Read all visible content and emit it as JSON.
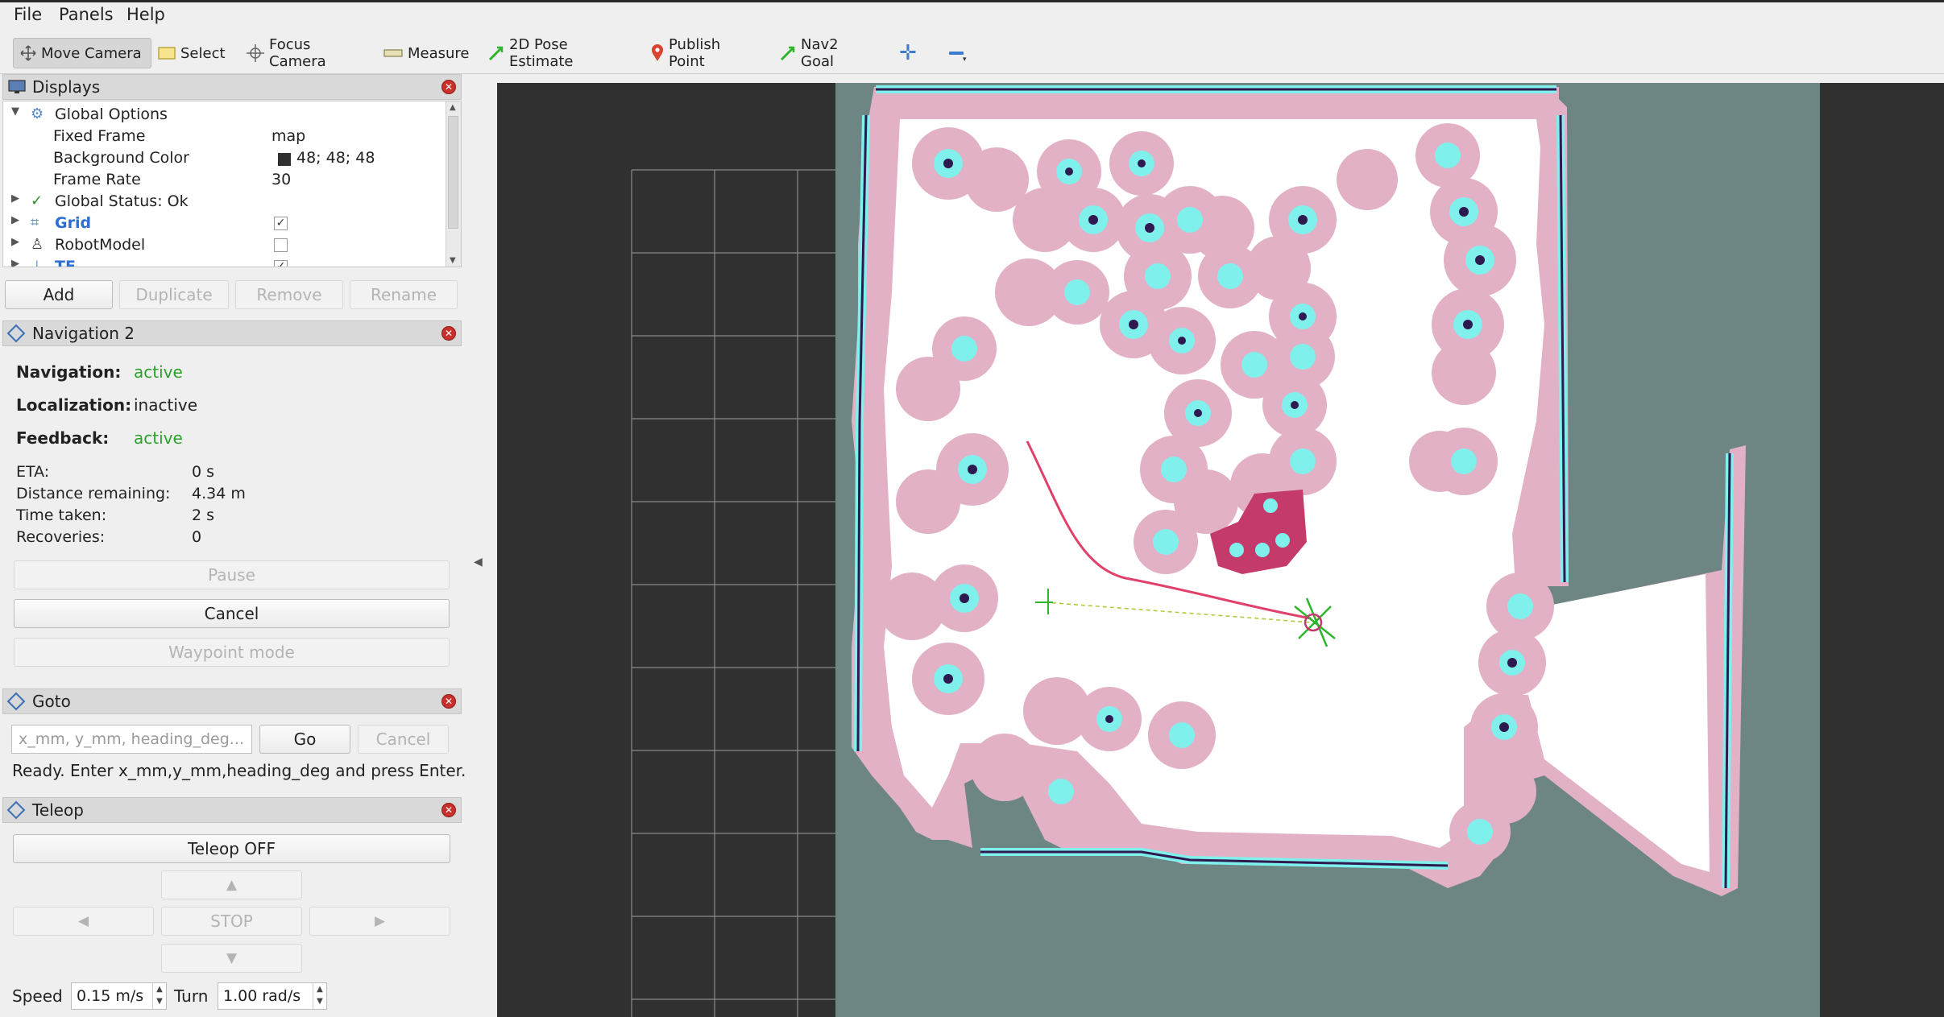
{
  "menu": {
    "file": "File",
    "panels": "Panels",
    "help": "Help"
  },
  "toolbar": {
    "move_camera": "Move Camera",
    "select": "Select",
    "focus_camera": "Focus Camera",
    "measure": "Measure",
    "pose_estimate": "2D Pose Estimate",
    "publish_point": "Publish Point",
    "nav2_goal": "Nav2 Goal",
    "add_icon": "plus-icon",
    "remove_icon": "minus-icon"
  },
  "displays": {
    "title": "Displays",
    "items": [
      {
        "label": "Global Options",
        "icon": "gear-icon"
      },
      {
        "label": "Fixed Frame",
        "value": "map"
      },
      {
        "label": "Background Color",
        "value": "48; 48; 48",
        "color": "#303030"
      },
      {
        "label": "Frame Rate",
        "value": "30"
      },
      {
        "label": "Global Status: Ok",
        "icon": "check-icon"
      },
      {
        "label": "Grid",
        "checked": true,
        "icon": "grid-icon"
      },
      {
        "label": "RobotModel",
        "checked": false,
        "icon": "robot-icon"
      },
      {
        "label": "TF",
        "checked": true,
        "icon": "axes-icon"
      }
    ],
    "buttons": {
      "add": "Add",
      "duplicate": "Duplicate",
      "remove": "Remove",
      "rename": "Rename"
    }
  },
  "navigation2": {
    "title": "Navigation 2",
    "navigation_label": "Navigation:",
    "navigation_value": "active",
    "localization_label": "Localization:",
    "localization_value": "inactive",
    "feedback_label": "Feedback:",
    "feedback_value": "active",
    "eta_label": "ETA:",
    "eta_value": "0 s",
    "distance_label": "Distance remaining:",
    "distance_value": "4.34 m",
    "time_label": "Time taken:",
    "time_value": "2 s",
    "recoveries_label": "Recoveries:",
    "recoveries_value": "0",
    "pause": "Pause",
    "cancel": "Cancel",
    "waypoint_mode": "Waypoint mode"
  },
  "goto": {
    "title": "Goto",
    "placeholder": "x_mm, y_mm, heading_deg...",
    "go": "Go",
    "cancel": "Cancel",
    "status": "Ready. Enter x_mm,y_mm,heading_deg and press Enter."
  },
  "teleop": {
    "title": "Teleop",
    "toggle": "Teleop OFF",
    "up": "▲",
    "left": "◀",
    "stop": "STOP",
    "right": "▶",
    "down": "▼",
    "speed_label": "Speed",
    "speed_value": "0.15 m/s",
    "turn_label": "Turn",
    "turn_value": "1.00 rad/s"
  },
  "colors": {
    "accent": "#2a6fd1",
    "status_active": "#2ca02c",
    "close": "#c9302c",
    "map_free": "#ffffff",
    "map_unknown": "#6d8684",
    "costmap_inflation": "#e2b1c6",
    "costmap_lethal": "#7ff0ec",
    "path": "#e0406a"
  }
}
